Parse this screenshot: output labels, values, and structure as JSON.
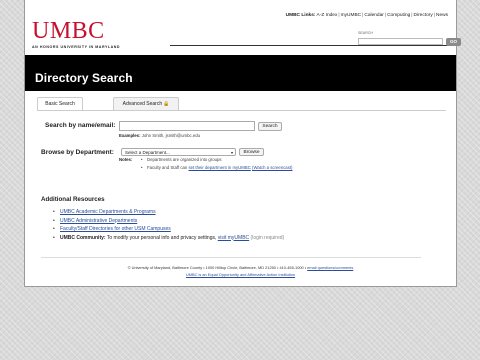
{
  "header": {
    "logo_word": "UMBC",
    "logo_tagline": "AN HONORS UNIVERSITY IN MARYLAND",
    "links_label": "UMBC Links:",
    "links": [
      "A-Z Index",
      "myUMBC",
      "Calendar",
      "Computing",
      "Directory",
      "News"
    ],
    "search_label": "SEARCH",
    "search_value": "",
    "search_button": "GO"
  },
  "banner": {
    "title": "Directory Search"
  },
  "tabs": [
    {
      "label": "Basic Search",
      "active": true
    },
    {
      "label": "Advanced Search",
      "active": false
    }
  ],
  "name_search": {
    "label": "Search by name/email:",
    "value": "",
    "button": "Search",
    "examples_label": "Examples:",
    "examples": "John Smith, jsmith@umbc.edu"
  },
  "department": {
    "label": "Browse by Department:",
    "selected": "Select a Department...",
    "button": "Browse",
    "notes_label": "Notes:",
    "note1": "Departments are organized into groups",
    "note2_prefix": "Faculty and Staff can",
    "note2_link": "set their department in myUMBC",
    "note2_link2": "(Watch a screencast)"
  },
  "resources": {
    "title": "Additional Resources",
    "items": [
      "UMBC Academic Departments & Programs",
      "UMBC Administrative Departments",
      "Faculty/Staff Directories for other USM Campuses"
    ],
    "community_label": "UMBC Community:",
    "community_text": "To modify your personal info and privacy settings,",
    "community_link": "visit myUMBC",
    "community_note": "(login required)"
  },
  "footer": {
    "line1": "© University of Maryland, Baltimore County • 1000 Hilltop Circle, Baltimore, MD 21250 • 410-455-1000 •",
    "line1_link": "email questions/comments",
    "line2_link": "UMBC is an Equal Opportunity and Affirmative Action Institution"
  },
  "colors": {
    "brand_red": "#c8102e",
    "banner_bg": "#000000",
    "link": "#2a4d9b"
  }
}
